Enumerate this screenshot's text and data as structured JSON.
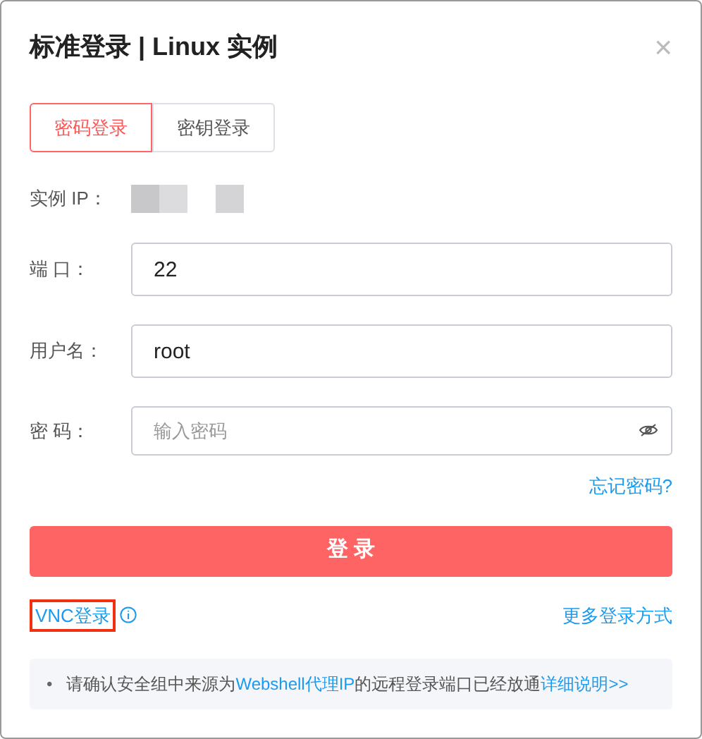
{
  "dialog": {
    "title": "标准登录 | Linux 实例",
    "close": "×"
  },
  "tabs": [
    {
      "label": "密码登录",
      "selected": true
    },
    {
      "label": "密钥登录",
      "selected": false
    }
  ],
  "fields": [
    {
      "kind": "redacted",
      "label": "实例 IP："
    },
    {
      "kind": "input",
      "label": "端 口：",
      "value": "22"
    },
    {
      "kind": "input",
      "label": "用户名：",
      "value": "root"
    },
    {
      "kind": "password",
      "label": "密 码：",
      "placeholder": "输入密码"
    }
  ],
  "forgot_link": "忘记密码?",
  "login_button": "登 录",
  "vnc_link": {
    "label": "VNC登录",
    "highlighted": true
  },
  "more_link": "更多登录方式",
  "note": {
    "bullet": "•",
    "segments": [
      {
        "kind": "text",
        "text": "请确认安全组中来源为"
      },
      {
        "kind": "emphasis",
        "text": "Webshell代理IP"
      },
      {
        "kind": "text",
        "text": "的远程登录端口已经放通"
      },
      {
        "kind": "link",
        "text": "详细说明>>"
      }
    ]
  }
}
